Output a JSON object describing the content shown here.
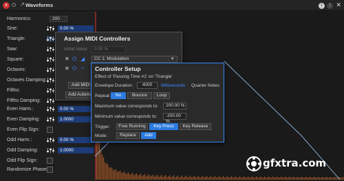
{
  "window": {
    "title": "Waveforms"
  },
  "harmonics": {
    "label": "Harmonics:",
    "value": "200"
  },
  "params": [
    {
      "label": "Sine:",
      "value": "0.00 %"
    },
    {
      "label": "Triangle:",
      "value": ""
    },
    {
      "label": "Saw:",
      "value": ""
    },
    {
      "label": "Square:",
      "value": ""
    },
    {
      "label": "Octaves:",
      "value": ""
    },
    {
      "label": "Octaves Damping:",
      "value": ""
    },
    {
      "label": "Fifths:",
      "value": ""
    },
    {
      "label": "Fifths Damping:",
      "value": ""
    },
    {
      "label": "Even Harm.:",
      "value": "0.00 %"
    },
    {
      "label": "Even Damping:",
      "value": "1.0000"
    },
    {
      "label": "Even Flip Sign:",
      "value": ""
    },
    {
      "label": "Odd Harm.:",
      "value": "0.00 %"
    },
    {
      "label": "Odd Damping:",
      "value": "1.0000"
    },
    {
      "label": "Odd Flip Sign:",
      "value": ""
    },
    {
      "label": "Randomize Phases:",
      "value": ""
    }
  ],
  "assign": {
    "title": "Assign MIDI Controllers",
    "initial_label": "Initial Value:",
    "initial_value": "0.00 %",
    "controller": "CC 1: Modulation",
    "add_midi_label": "Add MIDI C",
    "add_auto_label": "Add Automa"
  },
  "setup": {
    "title": "Controller Setup",
    "subtitle": "Effect of 'Passing Time #1' on 'Triangle'",
    "env_label": "Envelope Duration:",
    "env_value": "4000",
    "unit_ms": "Milliseconds",
    "unit_qn": "Quarter Notes",
    "repeat_label": "Repeat:",
    "repeat_opts": [
      "No",
      "Bounce",
      "Loop"
    ],
    "max_label": "Maximum value corresponds to:",
    "max_value": "200.00 %",
    "min_label": "Minimum value corresponds to:",
    "min_value": "-200.00 %",
    "trigger_label": "Trigger:",
    "trigger_opts": [
      "Free Running",
      "Key Press",
      "Key Release"
    ],
    "mode_label": "Mode:",
    "mode_opts": [
      "Replace",
      "Add"
    ]
  },
  "watermark": "gfxtra.com",
  "colors": {
    "accent": "#2c7be0",
    "harmonic_bars": "#b8622a",
    "wave_line": "#8aa8c8"
  }
}
